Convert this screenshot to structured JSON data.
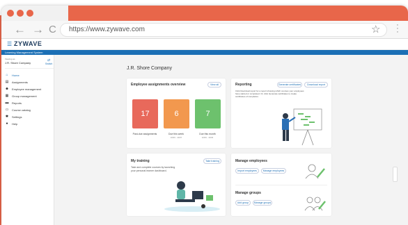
{
  "browser": {
    "url": "https://www.zywave.com",
    "back_icon": "arrow-left-icon",
    "forward_icon": "arrow-right-icon",
    "reload_icon": "reload-icon",
    "star_icon": "star-icon",
    "menu_icon": "kebab-icon"
  },
  "app": {
    "logo": "ZYWAVE",
    "system_name": "Learning Management System"
  },
  "sidebar": {
    "company_label": "Viewing as",
    "company_name": "J.R. Shore Company",
    "switch_label": "Switch",
    "items": [
      {
        "label": "Home",
        "icon": "home-icon"
      },
      {
        "label": "Assignments",
        "icon": "clipboard-icon"
      },
      {
        "label": "Employee management",
        "icon": "person-icon"
      },
      {
        "label": "Group management",
        "icon": "group-icon"
      },
      {
        "label": "Reports",
        "icon": "chart-icon"
      },
      {
        "label": "Course catalog",
        "icon": "book-icon"
      },
      {
        "label": "Settings",
        "icon": "gear-icon"
      },
      {
        "label": "Help",
        "icon": "help-icon"
      }
    ]
  },
  "main": {
    "page_title": "J.R. Shore Company",
    "assignments": {
      "title": "Employee assignments overview",
      "view_all": "View all",
      "tiles": [
        {
          "value": "17",
          "label": "Past-due assignments",
          "sub": "",
          "color": "#e8695b"
        },
        {
          "value": "6",
          "label": "Due this week",
          "sub": "10/06 - 10/07",
          "color": "#f2984e"
        },
        {
          "value": "7",
          "label": "Due this month",
          "sub": "10/06 - 10/30",
          "color": "#6dc16d"
        }
      ]
    },
    "reporting": {
      "title": "Reporting",
      "generate_btn": "Generate certificates",
      "download_btn": "Download report",
      "text": "Click Download report for a report showing which courses your employees have started or completed. Or, click Generate certificates to create certificates of completion."
    },
    "training": {
      "title": "My training",
      "take_btn": "Take training",
      "text": "Take and complete courses by launching your personal learner dashboard."
    },
    "manage_employees": {
      "title": "Manage employees",
      "import_btn": "Import employees",
      "manage_btn": "Manage employees"
    },
    "manage_groups": {
      "title": "Manage groups",
      "add_btn": "Add group",
      "manage_btn": "Manage groups"
    }
  },
  "colors": {
    "accent": "#1b6fb5",
    "background": "#e8664a"
  }
}
